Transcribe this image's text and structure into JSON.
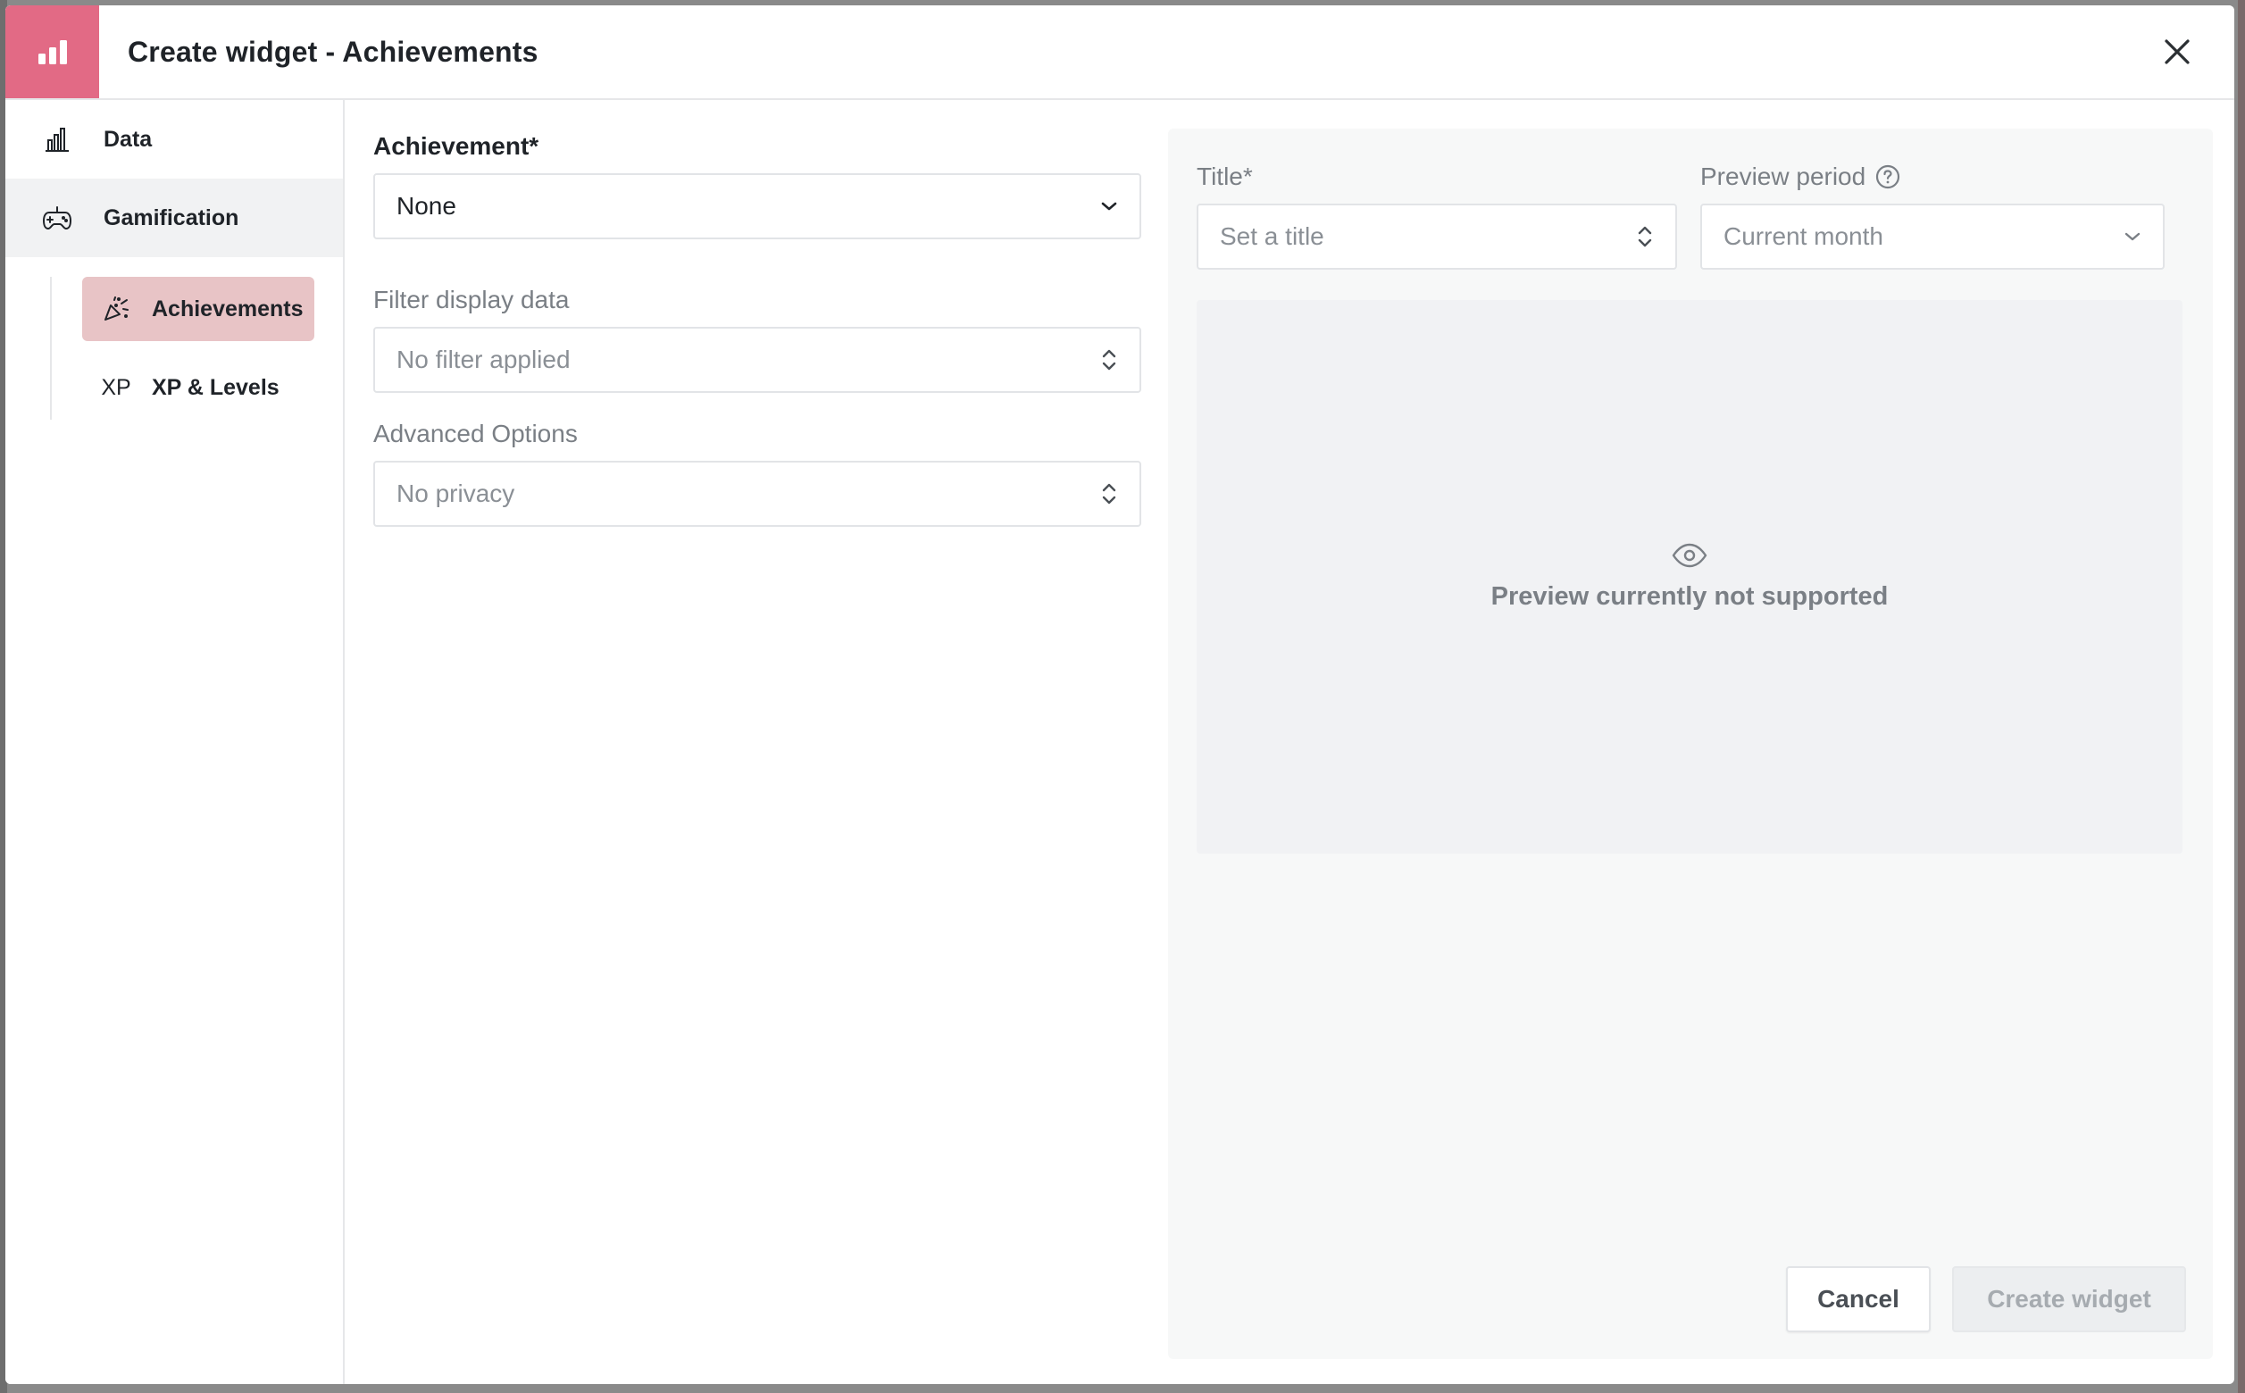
{
  "header": {
    "title": "Create widget - Achievements",
    "logo_icon": "bar-chart-icon",
    "accent_color": "#e26a85"
  },
  "sidebar": {
    "items": [
      {
        "label": "Data",
        "icon": "bar-chart-outline-icon"
      },
      {
        "label": "Gamification",
        "icon": "gamepad-icon"
      }
    ],
    "subitems": [
      {
        "label": "Achievements",
        "icon": "party-popper-icon"
      },
      {
        "label": "XP & Levels",
        "icon_text": "XP"
      }
    ]
  },
  "form": {
    "achievement_label": "Achievement*",
    "achievement_value": "None",
    "filter_label": "Filter display data",
    "filter_value": "No filter applied",
    "advanced_label": "Advanced Options",
    "advanced_value": "No privacy"
  },
  "preview": {
    "title_label": "Title*",
    "title_placeholder": "Set a title",
    "period_label": "Preview period",
    "period_value": "Current month",
    "message": "Preview currently not supported"
  },
  "footer": {
    "cancel_label": "Cancel",
    "create_label": "Create widget"
  }
}
